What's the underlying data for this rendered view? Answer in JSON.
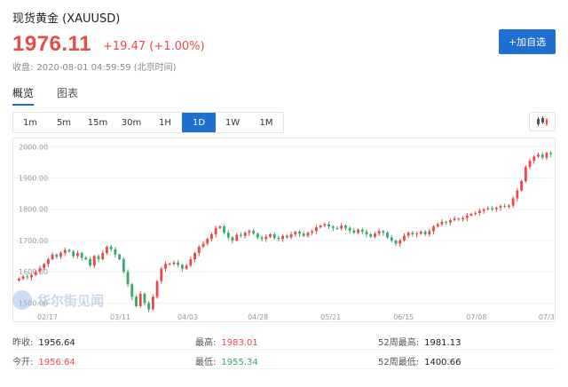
{
  "header": {
    "title": "现货黄金  (XAUUSD)",
    "price": "1976.11",
    "change": "+19.47 (+1.00%)",
    "close_label": "收盘:",
    "close_time": "2020-08-01 04:59:59 (北京时间)",
    "add_button": "+加自选"
  },
  "tabs": [
    {
      "label": "概览",
      "active": true
    },
    {
      "label": "图表",
      "active": false
    }
  ],
  "periods": [
    "1m",
    "5m",
    "15m",
    "30m",
    "1H",
    "1D",
    "1W",
    "1M"
  ],
  "active_period": "1D",
  "watermark": "华尔街见闻",
  "stats": {
    "prev_close_label": "昨收:",
    "prev_close": "1956.64",
    "high_label": "最高:",
    "high": "1983.01",
    "high52_label": "52周最高:",
    "high52": "1981.13",
    "open_label": "今开:",
    "open": "1956.64",
    "low_label": "最低:",
    "low": "1955.34",
    "low52_label": "52周最低:",
    "low52": "1400.66"
  },
  "colors": {
    "up": "#e84a4a",
    "down": "#3aa86b",
    "accent": "#1f6fd1"
  },
  "chart_data": {
    "type": "candlestick",
    "y_ticks": [
      "2000.00",
      "1900.00",
      "1800.00",
      "1700.00",
      "1600.00",
      "1500.00"
    ],
    "y_tick_values": [
      2000,
      1900,
      1800,
      1700,
      1600,
      1500
    ],
    "x_ticks": [
      "02/17",
      "03/11",
      "04/03",
      "04/28",
      "05/21",
      "06/15",
      "07/08",
      "07/3"
    ],
    "ylim": [
      1470,
      2015
    ],
    "closes": [
      1578,
      1585,
      1582,
      1590,
      1600,
      1612,
      1625,
      1640,
      1655,
      1648,
      1660,
      1670,
      1665,
      1650,
      1660,
      1645,
      1640,
      1620,
      1650,
      1640,
      1660,
      1680,
      1672,
      1655,
      1640,
      1600,
      1560,
      1520,
      1490,
      1530,
      1500,
      1480,
      1520,
      1570,
      1610,
      1625,
      1625,
      1630,
      1622,
      1610,
      1620,
      1640,
      1660,
      1680,
      1690,
      1705,
      1720,
      1740,
      1745,
      1725,
      1710,
      1700,
      1718,
      1715,
      1725,
      1730,
      1722,
      1710,
      1705,
      1712,
      1720,
      1708,
      1705,
      1715,
      1710,
      1720,
      1728,
      1722,
      1715,
      1725,
      1730,
      1742,
      1748,
      1752,
      1745,
      1740,
      1738,
      1748,
      1740,
      1732,
      1725,
      1735,
      1728,
      1720,
      1712,
      1722,
      1730,
      1725,
      1710,
      1700,
      1690,
      1700,
      1715,
      1725,
      1720,
      1722,
      1728,
      1720,
      1730,
      1745,
      1752,
      1760,
      1758,
      1765,
      1770,
      1768,
      1772,
      1780,
      1785,
      1788,
      1795,
      1800,
      1803,
      1800,
      1805,
      1810,
      1808,
      1812,
      1835,
      1860,
      1890,
      1935,
      1955,
      1968,
      1975,
      1965,
      1980,
      1976
    ]
  }
}
